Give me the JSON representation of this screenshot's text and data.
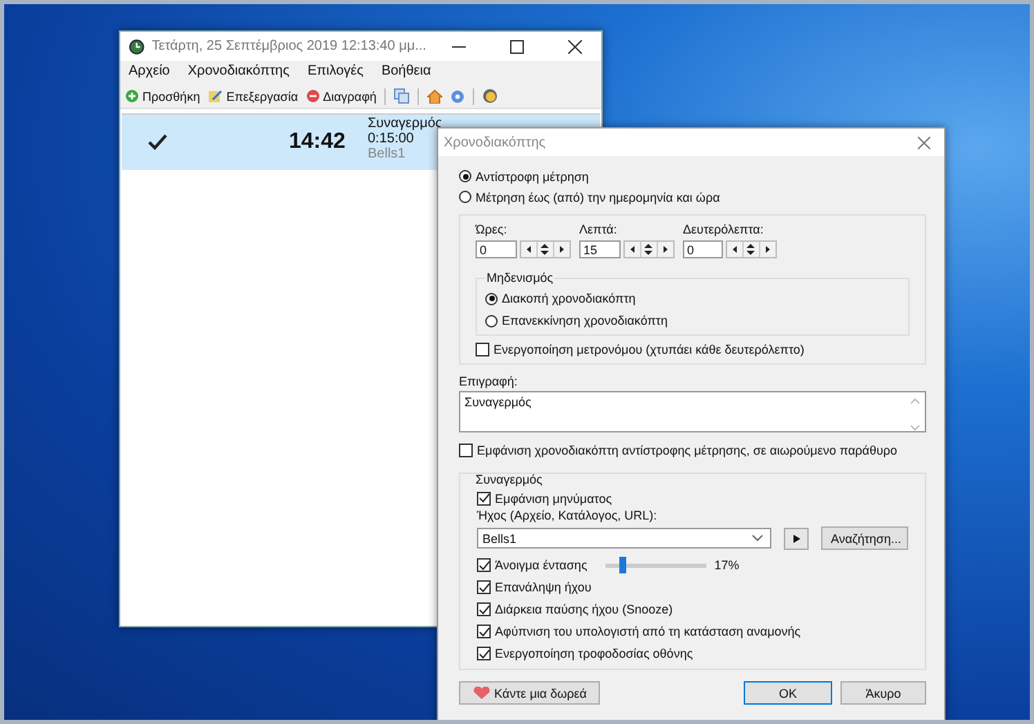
{
  "main_window": {
    "title": "Τετάρτη, 25 Σεπτέμβριος 2019 12:13:40 μμ...",
    "menu": [
      "Αρχείο",
      "Χρονοδιακόπτης",
      "Επιλογές",
      "Βοήθεια"
    ],
    "toolbar": [
      {
        "label": "Προσθήκη",
        "kind": "add"
      },
      {
        "label": "Επεξεργασία",
        "kind": "edit"
      },
      {
        "label": "Διαγραφή",
        "kind": "delete"
      }
    ],
    "timers": [
      {
        "selected": true,
        "checked": true,
        "time": "14:42",
        "name": "Συναγερμός",
        "duration": "0:15:00",
        "sound": "Bells1"
      }
    ]
  },
  "dialog": {
    "title": "Χρονοδιακόπτης",
    "modes": [
      {
        "label": "Αντίστροφη μέτρηση",
        "selected": true
      },
      {
        "label": "Μέτρηση έως (από) την ημερομηνία και ώρα",
        "selected": false
      }
    ],
    "fields": [
      {
        "label": "Ώρες:",
        "value": "0"
      },
      {
        "label": "Λεπτά:",
        "value": "15"
      },
      {
        "label": "Δευτερόλεπτα:",
        "value": "0"
      }
    ],
    "reset": {
      "title": "Μηδενισμός",
      "options": [
        {
          "label": "Διακοπή χρονοδιακόπτη",
          "selected": true
        },
        {
          "label": "Επανεκκίνηση χρονοδιακόπτη",
          "selected": false
        }
      ]
    },
    "metronome": {
      "label": "Ενεργοποίηση μετρονόμου (χτυπάει κάθε δευτερόλεπτο)",
      "checked": false
    },
    "caption": {
      "label": "Επιγραφή:",
      "value": "Συναγερμός"
    },
    "floating": {
      "label": "Εμφάνιση χρονοδιακόπτη αντίστροφης μέτρησης, σε αιωρούμενο παράθυρο",
      "checked": false
    },
    "alarm": {
      "title": "Συναγερμός",
      "show_message": {
        "label": "Εμφάνιση μηνύματος",
        "checked": true
      },
      "sound_label": "Ήχος (Αρχείο, Κατάλογος, URL):",
      "sound_value": "Bells1",
      "browse": "Αναζήτηση...",
      "options": [
        {
          "kind": "slider",
          "label": "Άνοιγμα έντασης",
          "checked": true,
          "level": 0.17,
          "reading": "17%"
        },
        {
          "kind": "check",
          "label": "Επανάληψη ήχου",
          "checked": true
        },
        {
          "kind": "check",
          "label": "Διάρκεια παύσης ήχου (Snooze)",
          "checked": true
        },
        {
          "kind": "check",
          "label": "Αφύπνιση του υπολογιστή από τη κατάσταση αναμονής",
          "checked": true
        },
        {
          "kind": "check",
          "label": "Ενεργοποίηση τροφοδοσίας οθόνης",
          "checked": true
        }
      ]
    },
    "donate": "Κάντε μια δωρεά",
    "ok": "OK",
    "cancel": "Άκυρο"
  }
}
